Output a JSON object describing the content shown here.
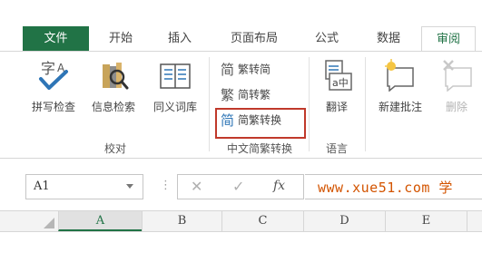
{
  "tabs": [
    {
      "label": "文件"
    },
    {
      "label": "开始"
    },
    {
      "label": "插入"
    },
    {
      "label": "页面布局"
    },
    {
      "label": "公式"
    },
    {
      "label": "数据"
    },
    {
      "label": "审阅"
    }
  ],
  "ribbon": {
    "proofing": {
      "spell_check": "拼写检查",
      "research": "信息检索",
      "thesaurus": "同义词库",
      "group_label": "校对"
    },
    "chinese_conversion": {
      "trad_to_simp": "繁转简",
      "simp_to_trad": "简转繁",
      "convert": "简繁转换",
      "group_label": "中文简繁转换"
    },
    "language": {
      "translate": "翻译",
      "group_label": "语言"
    },
    "comments": {
      "new_comment": "新建批注",
      "delete": "删除"
    }
  },
  "formula_bar": {
    "name_box": "A1",
    "cancel_glyph": "✕",
    "enter_glyph": "✓",
    "fx_label": "fx",
    "content": "www.xue51.com 学"
  },
  "columns": [
    "A",
    "B",
    "C",
    "D",
    "E"
  ],
  "colors": {
    "accent": "#217346",
    "highlight_border": "#c0392b",
    "formula_text": "#d35400"
  }
}
